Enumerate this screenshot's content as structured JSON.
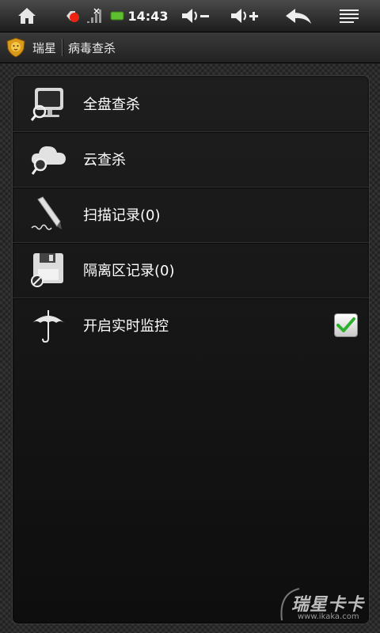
{
  "status_bar": {
    "time": "14:43",
    "icons": [
      "home-icon",
      "notification-icon",
      "signal-icon",
      "battery-icon",
      "volume-down-icon",
      "volume-up-icon",
      "back-icon",
      "menu-icon"
    ]
  },
  "title_bar": {
    "app_name": "瑞星",
    "page_title": "病毒查杀"
  },
  "menu": {
    "items": [
      {
        "label": "全盘查杀",
        "icon": "monitor-search-icon"
      },
      {
        "label": "云查杀",
        "icon": "cloud-search-icon"
      },
      {
        "label": "扫描记录(0)",
        "icon": "pen-icon"
      },
      {
        "label": "隔离区记录(0)",
        "icon": "floppy-block-icon"
      },
      {
        "label": "开启实时监控",
        "icon": "umbrella-icon",
        "checked": true
      }
    ]
  },
  "watermark": {
    "text": "瑞星卡卡",
    "url": "www.ikaka.com"
  },
  "colors": {
    "check_green": "#2bb12b",
    "panel_bg": "#181818",
    "label": "#ffffff"
  }
}
